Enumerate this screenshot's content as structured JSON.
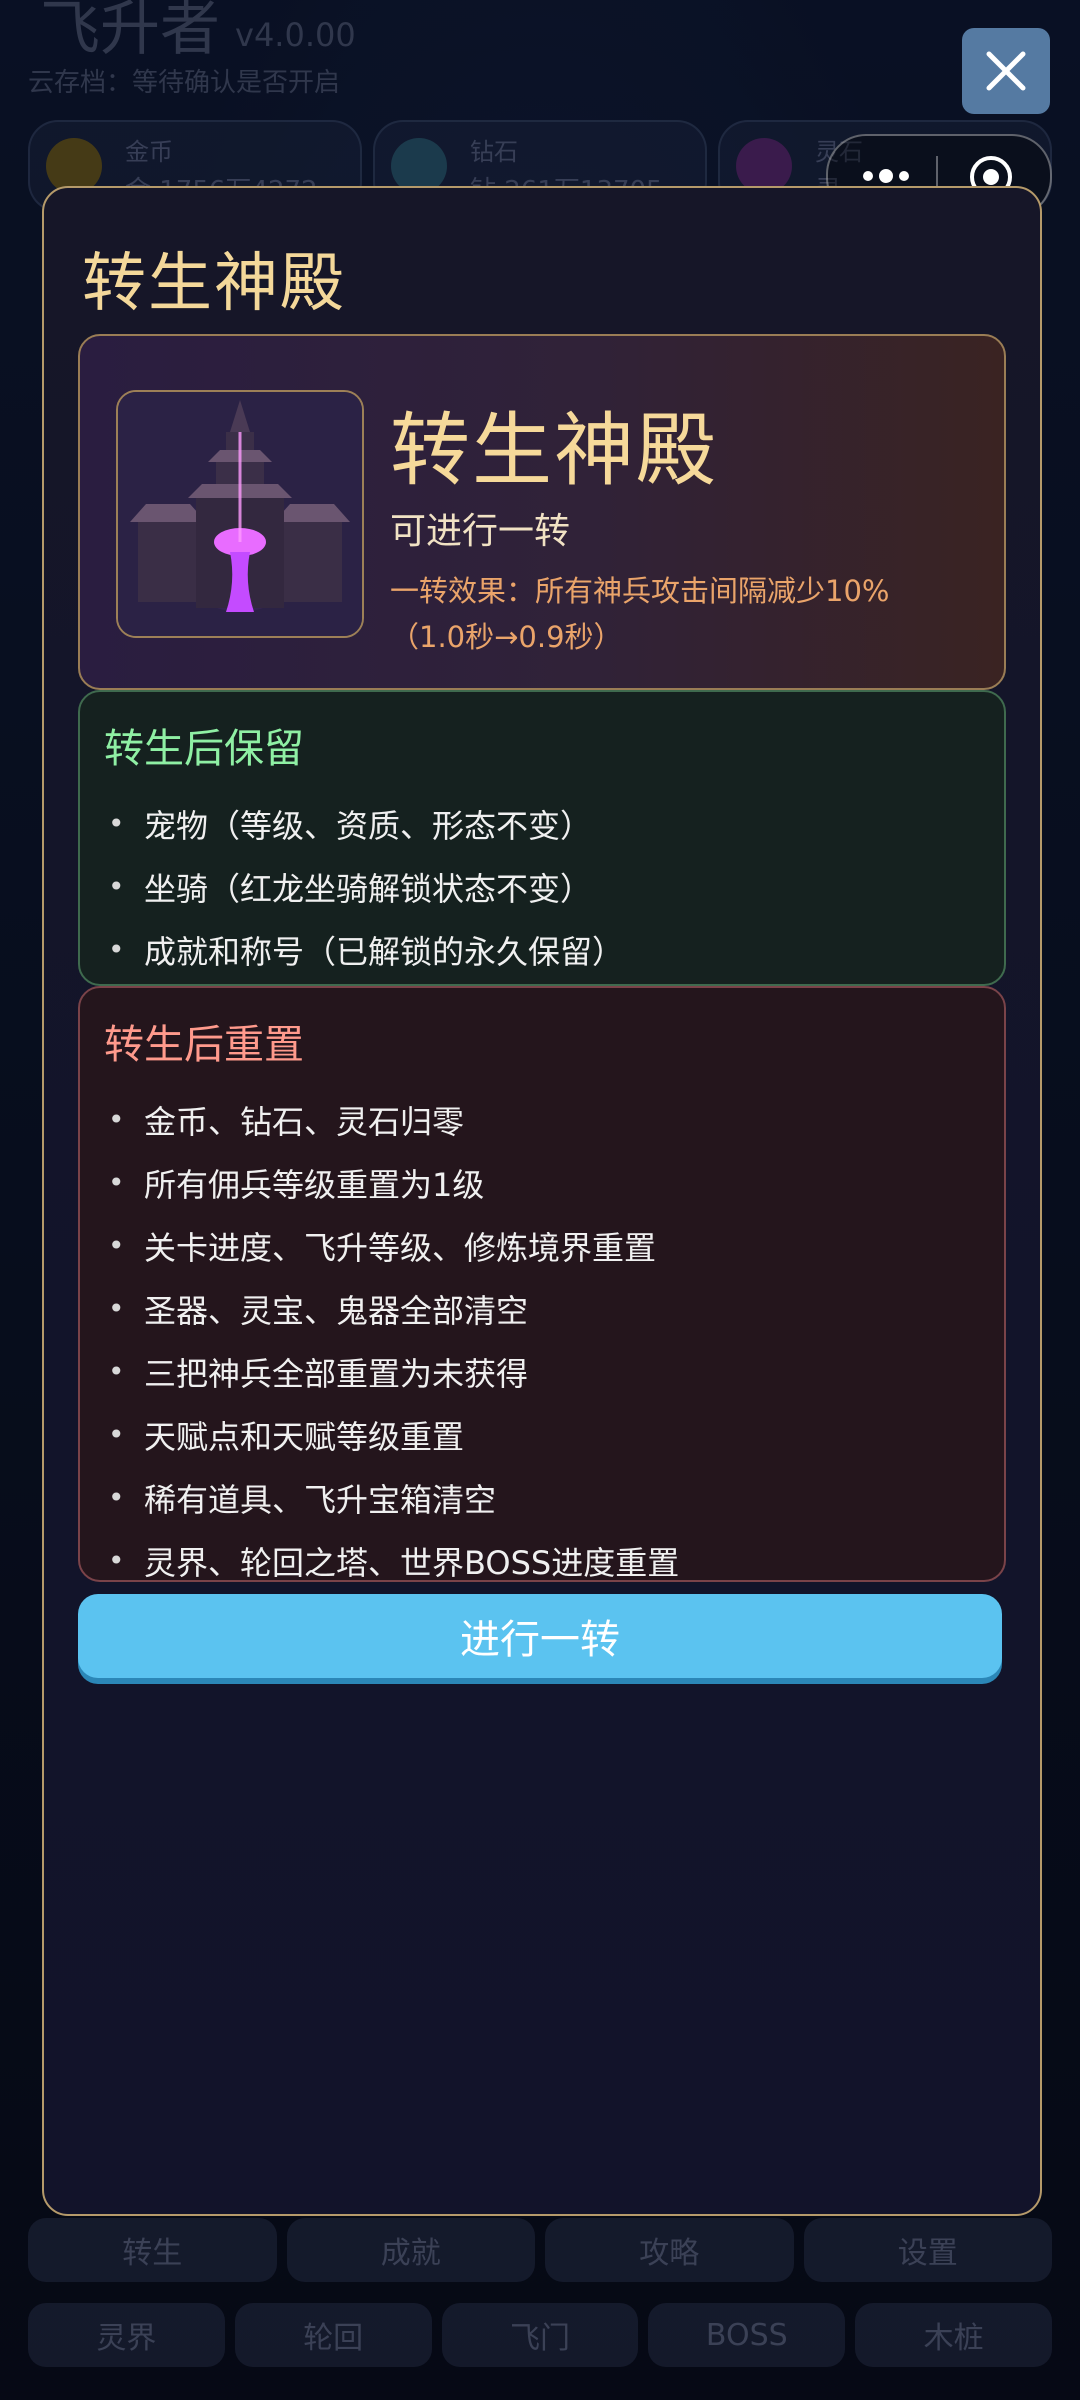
{
  "background": {
    "title": "飞升者",
    "version": "v4.0.00",
    "cloud_status": "云存档：等待确认是否开启",
    "resources": [
      {
        "label": "金币",
        "value": "金 1756万4272"
      },
      {
        "label": "钻石",
        "value": "钻 261万13705"
      },
      {
        "label": "灵石",
        "value": "灵"
      }
    ],
    "bottom_row1": [
      "转生",
      "成就",
      "攻略",
      "设置"
    ],
    "bottom_row2": [
      "灵界",
      "轮回",
      "飞门",
      "BOSS",
      "木桩"
    ]
  },
  "modal": {
    "title": "转生神殿",
    "hero": {
      "name": "转生神殿",
      "status": "可进行一转",
      "effect_line1": "一转效果：所有神兵攻击间隔减少10%",
      "effect_line2": "（1.0秒→0.9秒）"
    },
    "keep": {
      "title": "转生后保留",
      "items": [
        "宠物（等级、资质、形态不变）",
        "坐骑（红龙坐骑解锁状态不变）",
        "成就和称号（已解锁的永久保留）"
      ]
    },
    "reset": {
      "title": "转生后重置",
      "items": [
        "金币、钻石、灵石归零",
        "所有佣兵等级重置为1级",
        "关卡进度、飞升等级、修炼境界重置",
        "圣器、灵宝、鬼器全部清空",
        "三把神兵全部重置为未获得",
        "天赋点和天赋等级重置",
        "稀有道具、飞升宝箱清空",
        "灵界、轮回之塔、世界BOSS进度重置"
      ]
    },
    "action_label": "进行一转"
  },
  "colors": {
    "accent_gold": "#f4d89a",
    "keep_green": "#8ff0a4",
    "reset_red": "#ff9a8c",
    "action_blue": "#5bc3f0"
  }
}
